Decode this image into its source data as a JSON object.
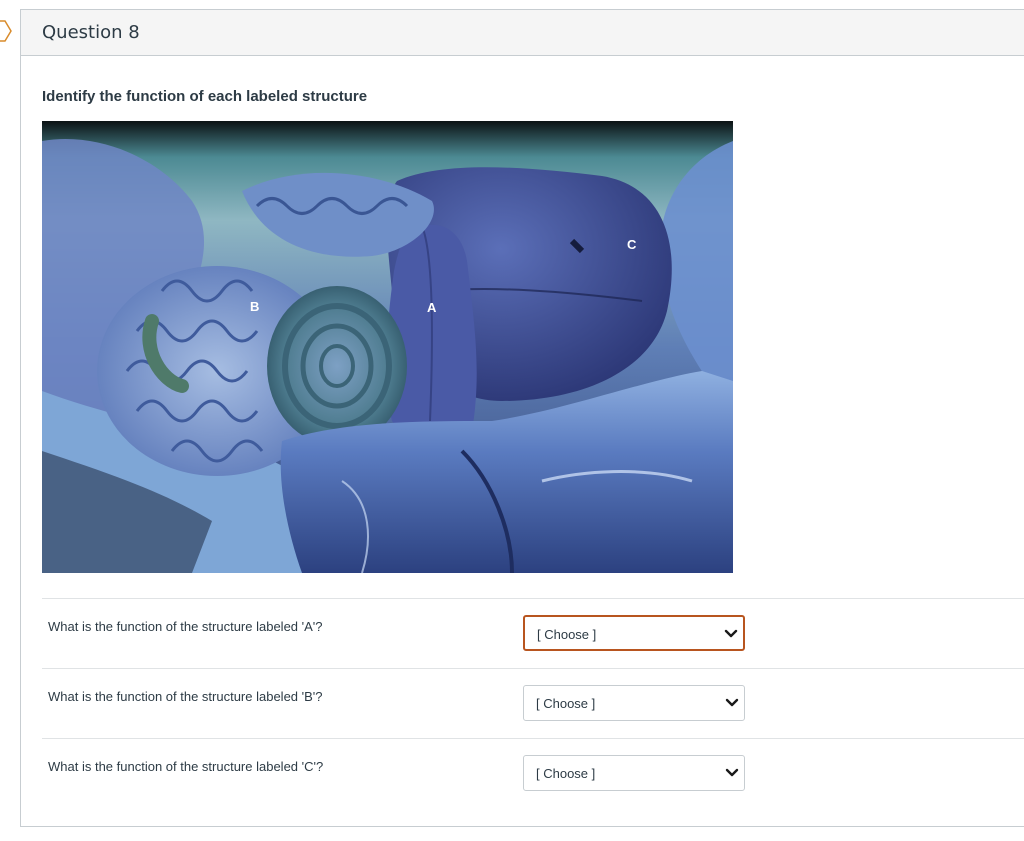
{
  "question": {
    "title": "Question 8",
    "prompt": "Identify the function of each labeled structure"
  },
  "image": {
    "labels": {
      "a": "A",
      "b": "B",
      "c": "C"
    }
  },
  "answers": [
    {
      "label": "What is the function of the structure labeled 'A'?",
      "selected": "[ Choose ]"
    },
    {
      "label": "What is the function of the structure labeled 'B'?",
      "selected": "[ Choose ]"
    },
    {
      "label": "What is the function of the structure labeled 'C'?",
      "selected": "[ Choose ]"
    }
  ],
  "colors": {
    "focus_border": "#b8551f",
    "text": "#2d3b45",
    "header_bg": "#f5f5f5",
    "border": "#c7cdd1"
  },
  "icons": {
    "flag": "flag-tab-icon",
    "dropdown": "chevron-down-icon"
  }
}
